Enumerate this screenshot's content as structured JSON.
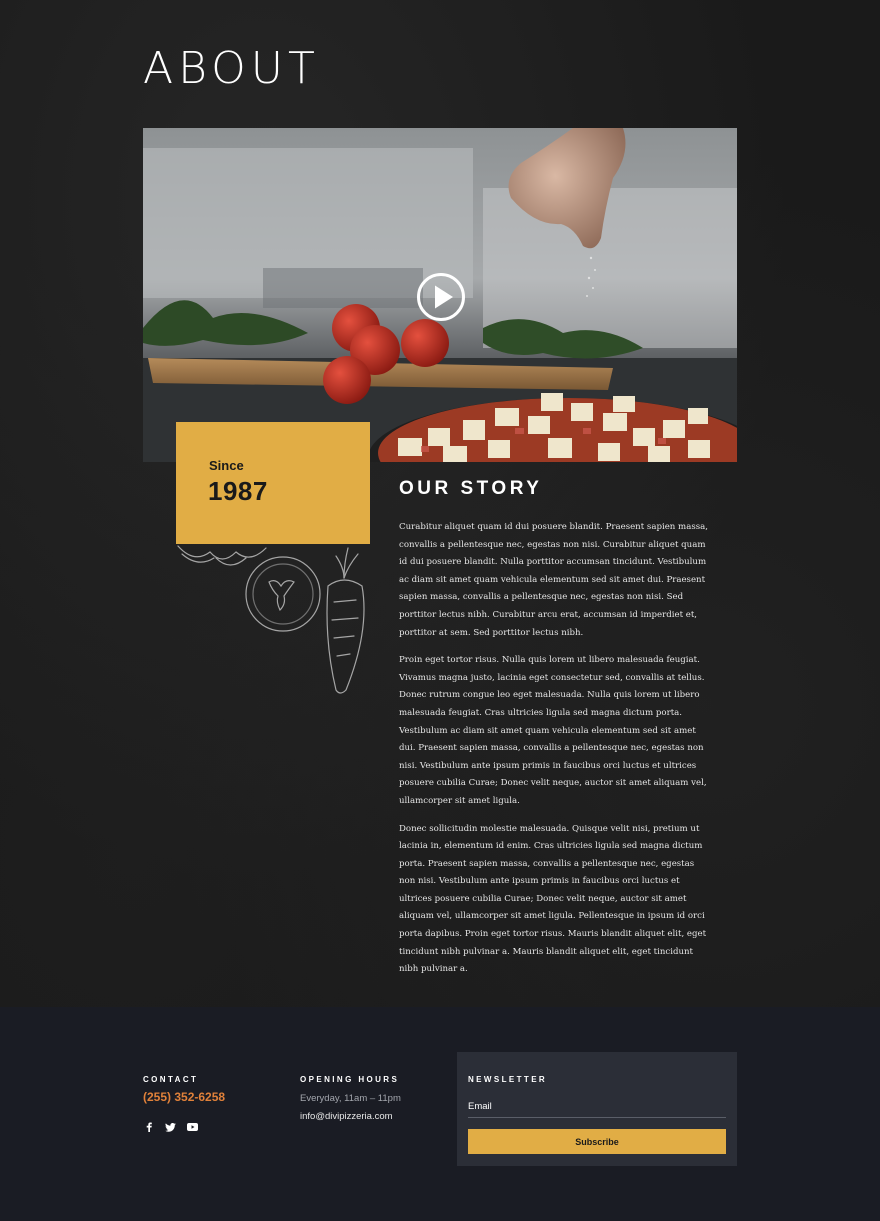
{
  "page": {
    "title": "ABOUT"
  },
  "hero": {
    "icon": "play-icon"
  },
  "since": {
    "label": "Since",
    "year": "1987"
  },
  "story": {
    "heading": "OUR STORY",
    "paragraphs": [
      "Curabitur aliquet quam id dui posuere blandit. Praesent sapien massa, convallis a pellentesque nec, egestas non nisi. Curabitur aliquet quam id dui posuere blandit. Nulla porttitor accumsan tincidunt. Vestibulum ac diam sit amet quam vehicula elementum sed sit amet dui. Praesent sapien massa, convallis a pellentesque nec, egestas non nisi. Sed porttitor lectus nibh. Curabitur arcu erat, accumsan id imperdiet et, porttitor at sem. Sed porttitor lectus nibh.",
      "Proin eget tortor risus. Nulla quis lorem ut libero malesuada feugiat. Vivamus magna justo, lacinia eget consectetur sed, convallis at tellus. Donec rutrum congue leo eget malesuada. Nulla quis lorem ut libero malesuada feugiat. Cras ultricies ligula sed magna dictum porta. Vestibulum ac diam sit amet quam vehicula elementum sed sit amet dui. Praesent sapien massa, convallis a pellentesque nec, egestas non nisi. Vestibulum ante ipsum primis in faucibus orci luctus et ultrices posuere cubilia Curae; Donec velit neque, auctor sit amet aliquam vel, ullamcorper sit amet ligula.",
      "Donec sollicitudin molestie malesuada. Quisque velit nisi, pretium ut lacinia in, elementum id enim. Cras ultricies ligula sed magna dictum porta. Praesent sapien massa, convallis a pellentesque nec, egestas non nisi. Vestibulum ante ipsum primis in faucibus orci luctus et ultrices posuere cubilia Curae; Donec velit neque, auctor sit amet aliquam vel, ullamcorper sit amet ligula. Pellentesque in ipsum id orci porta dapibus. Proin eget tortor risus. Mauris blandit aliquet elit, eget tincidunt nibh pulvinar a. Mauris blandit aliquet elit, eget tincidunt nibh pulvinar a."
    ]
  },
  "footer": {
    "contact": {
      "heading": "CONTACT",
      "phone": "(255) 352-6258",
      "socials": [
        "facebook-icon",
        "twitter-icon",
        "youtube-icon"
      ]
    },
    "hours": {
      "heading": "OPENING HOURS",
      "text": "Everyday, 11am – 11pm",
      "email": "info@divipizzeria.com"
    },
    "newsletter": {
      "heading": "NEWSLETTER",
      "email_placeholder": "Email",
      "button": "Subscribe"
    }
  },
  "colors": {
    "accent": "#e1ad45",
    "phone": "#e0813a",
    "footer_bg": "#1a1c24",
    "panel_bg": "#2b2e37"
  }
}
